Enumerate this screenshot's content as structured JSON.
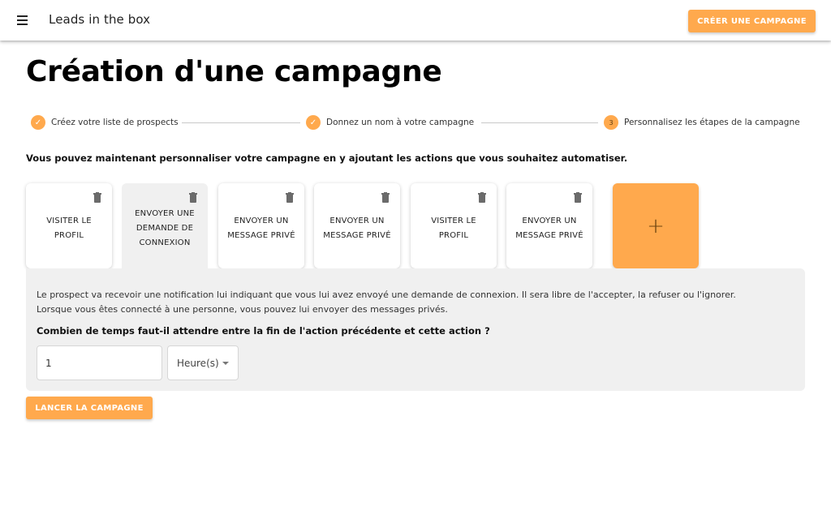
{
  "header": {
    "app_title": "Leads in the box",
    "menu_icon": "hamburger-menu-icon",
    "create_campaign_label": "CRÉER UNE CAMPAGNE"
  },
  "page": {
    "title": "Création d'une campagne",
    "intro": "Vous pouvez maintenant personnaliser votre campagne en y ajoutant les actions que vous souhaitez automatiser."
  },
  "stepper": {
    "steps": [
      {
        "label": "Créez votre liste de prospects",
        "status": "completed",
        "icon": "check-icon",
        "marker": "✓"
      },
      {
        "label": "Donnez un nom à votre campagne",
        "status": "completed",
        "icon": "check-icon",
        "marker": "✓"
      },
      {
        "label": "Personnalisez les étapes de la campagne",
        "status": "active",
        "marker": "3"
      }
    ]
  },
  "actions": [
    {
      "label": "VISITER LE PROFIL",
      "selected": false
    },
    {
      "label": "ENVOYER UNE DEMANDE DE CONNEXION",
      "selected": true
    },
    {
      "label": "ENVOYER UN MESSAGE PRIVÉ",
      "selected": false
    },
    {
      "label": "ENVOYER UN MESSAGE PRIVÉ",
      "selected": false
    },
    {
      "label": "VISITER LE PROFIL",
      "selected": false
    },
    {
      "label": "ENVOYER UN MESSAGE PRIVÉ",
      "selected": false
    }
  ],
  "add_action": {
    "symbol": "+"
  },
  "detail": {
    "description_line1": "Le prospect va recevoir une notification lui indiquant que vous lui avez envoyé une demande de connexion. Il sera libre de l'accepter, la refuser ou l'ignorer.",
    "description_line2": "Lorsque vous êtes connecté à une personne, vous pouvez lui envoyer des messages privés.",
    "question": "Combien de temps faut-il attendre entre la fin de l'action précédente et cette action ?",
    "delay_value": "1",
    "delay_unit": "Heure(s)"
  },
  "launch_label": "LANCER LA CAMPAGNE",
  "colors": {
    "accent": "#ffa94d",
    "panel_bg": "#f0f0f0",
    "icon_gray": "#6b6b6b"
  }
}
